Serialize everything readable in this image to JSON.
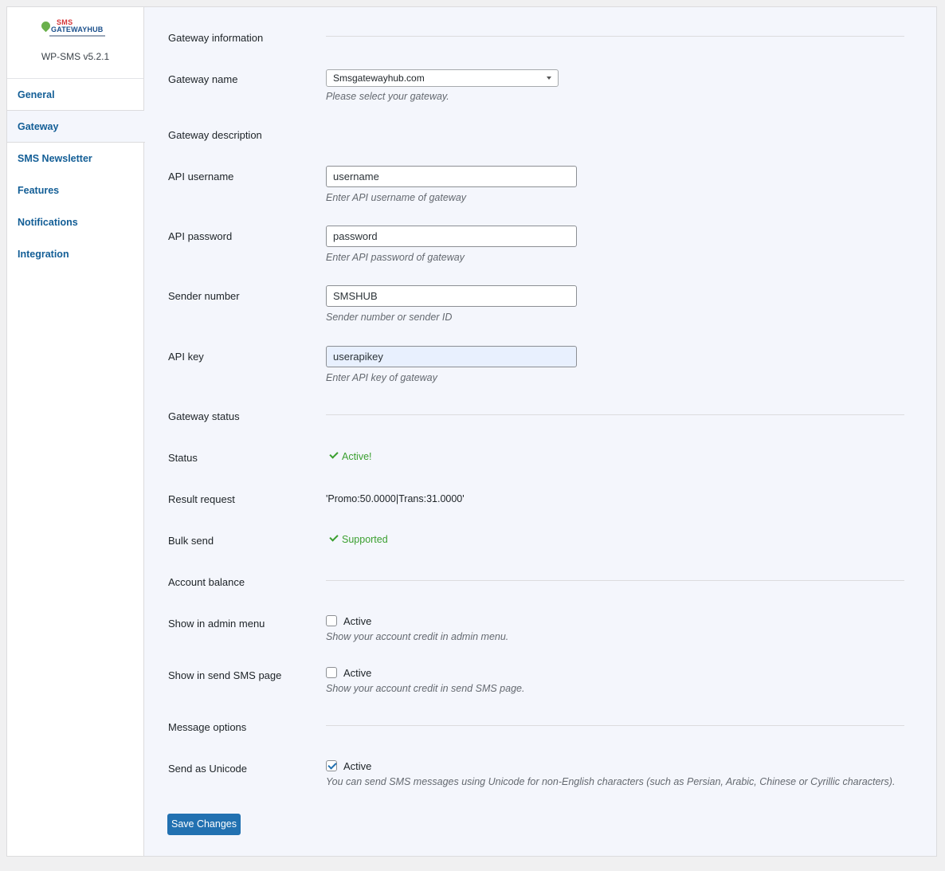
{
  "sidebar": {
    "logo": {
      "line1": "SMS",
      "line2": "GATEWAYHUB"
    },
    "version": "WP-SMS v5.2.1",
    "items": [
      {
        "label": "General"
      },
      {
        "label": "Gateway"
      },
      {
        "label": "SMS Newsletter"
      },
      {
        "label": "Features"
      },
      {
        "label": "Notifications"
      },
      {
        "label": "Integration"
      }
    ],
    "active_item": "Gateway"
  },
  "sections": {
    "gateway_information": "Gateway information",
    "gateway_status": "Gateway status",
    "account_balance": "Account balance",
    "message_options": "Message options"
  },
  "fields": {
    "gateway_name": {
      "label": "Gateway name",
      "value": "Smsgatewayhub.com",
      "description": "Please select your gateway."
    },
    "gateway_description": {
      "label": "Gateway description"
    },
    "api_username": {
      "label": "API username",
      "value": "username",
      "description": "Enter API username of gateway"
    },
    "api_password": {
      "label": "API password",
      "value": "password",
      "description": "Enter API password of gateway"
    },
    "sender_number": {
      "label": "Sender number",
      "value": "SMSHUB",
      "description": "Sender number or sender ID"
    },
    "api_key": {
      "label": "API key",
      "value": "userapikey",
      "description": "Enter API key of gateway"
    }
  },
  "status": {
    "status": {
      "label": "Status",
      "value": "Active!"
    },
    "result_request": {
      "label": "Result request",
      "value": "'Promo:50.0000|Trans:31.0000'"
    },
    "bulk_send": {
      "label": "Bulk send",
      "value": "Supported"
    }
  },
  "balance": {
    "admin_menu": {
      "label": "Show in admin menu",
      "checkbox_label": "Active",
      "checked": false,
      "description": "Show your account credit in admin menu."
    },
    "send_sms_page": {
      "label": "Show in send SMS page",
      "checkbox_label": "Active",
      "checked": false,
      "description": "Show your account credit in send SMS page."
    }
  },
  "message": {
    "unicode": {
      "label": "Send as Unicode",
      "checkbox_label": "Active",
      "checked": true,
      "description": "You can send SMS messages using Unicode for non-English characters (such as Persian, Arabic, Chinese or Cyrillic characters)."
    }
  },
  "save_label": "Save Changes",
  "colors": {
    "accent": "#2271b1",
    "link": "#135e96",
    "success": "#3a9f2f",
    "panel_bg": "#f4f6fc"
  }
}
